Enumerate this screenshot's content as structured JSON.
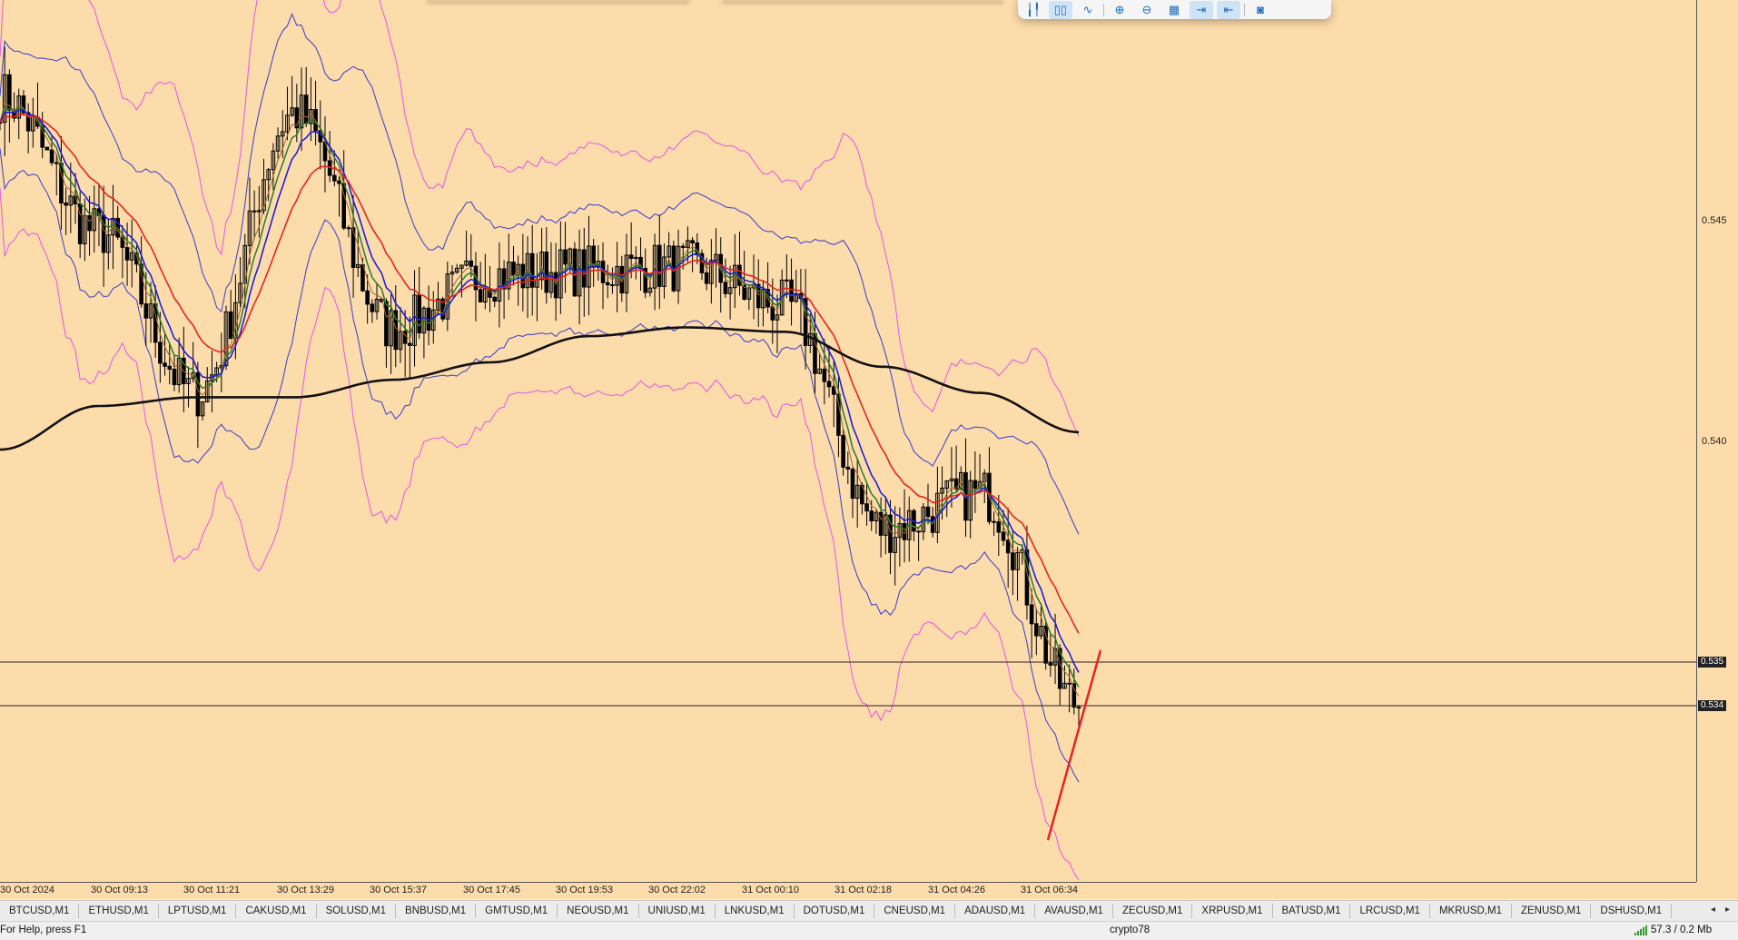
{
  "chart": {
    "price_levels": [
      "0.545",
      "0.540"
    ],
    "current_price_tags": [
      "0.535",
      "0.534"
    ],
    "time_labels": [
      "30 Oct 2024",
      "30 Oct 09:13",
      "30 Oct 11:21",
      "30 Oct 13:29",
      "30 Oct 15:37",
      "30 Oct 17:45",
      "30 Oct 19:53",
      "30 Oct 22:02",
      "31 Oct 00:10",
      "31 Oct 02:18",
      "31 Oct 04:26",
      "31 Oct 06:34"
    ],
    "background_color": "#fddcab",
    "colors": {
      "candles": "#000000",
      "ma_red": "#e8231e",
      "ma_blue": "#1f1fd6",
      "ma_green": "#2b7a2b",
      "ma_black": "#111111",
      "bollinger_inner": "#4848c8",
      "bollinger_outer": "#e85fe0",
      "trendline": "#e8231e"
    }
  },
  "chart_data": {
    "type": "line",
    "title": "",
    "xlabel": "",
    "ylabel": "",
    "x": [
      "30 Oct 2024",
      "30 Oct 09:13",
      "30 Oct 11:21",
      "30 Oct 13:29",
      "30 Oct 15:37",
      "30 Oct 17:45",
      "30 Oct 19:53",
      "30 Oct 22:02",
      "31 Oct 00:10",
      "31 Oct 02:18",
      "31 Oct 04:26",
      "31 Oct 06:34"
    ],
    "ylim": [
      0.5286,
      0.5488
    ],
    "grid": false,
    "horizontal_lines": [
      0.535,
      0.534
    ],
    "series": [
      {
        "values": [
          0.5466,
          0.5435,
          0.5398,
          0.5462,
          0.5413,
          0.5425,
          0.5426,
          0.5427,
          0.5418,
          0.5367,
          0.5375,
          0.5327
        ]
      },
      {
        "values": [
          0.5385,
          0.5395,
          0.5397,
          0.5397,
          0.5401,
          0.5405,
          0.5411,
          0.5413,
          0.5412,
          0.5404,
          0.5398,
          0.5389
        ]
      }
    ]
  },
  "toolbar": {
    "buttons": [
      {
        "name": "bar-chart-icon",
        "glyph": "╽╿"
      },
      {
        "name": "candlestick-icon",
        "glyph": "▯▯"
      },
      {
        "name": "line-chart-icon",
        "glyph": "∿"
      },
      {
        "name": "zoom-in-icon",
        "glyph": "⊕"
      },
      {
        "name": "zoom-out-icon",
        "glyph": "⊖"
      },
      {
        "name": "grid-icon",
        "glyph": "▦"
      },
      {
        "name": "autoscroll-icon",
        "glyph": "⇥"
      },
      {
        "name": "chart-shift-icon",
        "glyph": "⇤"
      },
      {
        "name": "screenshot-icon",
        "glyph": "◙"
      }
    ]
  },
  "symbol_tabs": [
    "BTCUSD,M1",
    "ETHUSD,M1",
    "LPTUSD,M1",
    "CAKUSD,M1",
    "SOLUSD,M1",
    "BNBUSD,M1",
    "GMTUSD,M1",
    "NEOUSD,M1",
    "UNIUSD,M1",
    "LNKUSD,M1",
    "DOTUSD,M1",
    "CNEUSD,M1",
    "ADAUSD,M1",
    "AVAUSD,M1",
    "ZECUSD,M1",
    "XRPUSD,M1",
    "BATUSD,M1",
    "LRCUSD,M1",
    "MKRUSD,M1",
    "ZENUSD,M1",
    "DSHUSD,M1"
  ],
  "status": {
    "help": "For Help, press F1",
    "profile": "crypto78",
    "traffic": "57.3 / 0.2 Mb"
  }
}
